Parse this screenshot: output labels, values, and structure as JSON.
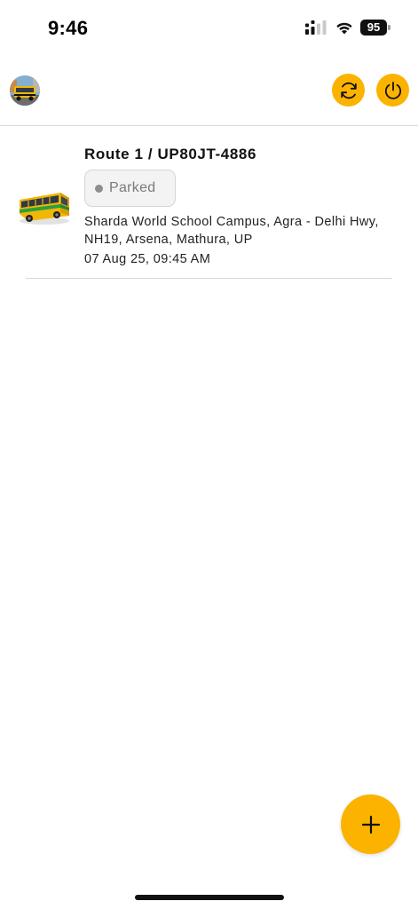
{
  "status_bar": {
    "time": "9:46",
    "battery_level": "95",
    "signal_icon": "cellular-signal-icon",
    "wifi_icon": "wifi-icon"
  },
  "header": {
    "avatar_icon": "school-bus-avatar-icon",
    "refresh_icon": "refresh-icon",
    "power_icon": "power-icon"
  },
  "vehicles": [
    {
      "title": "Route 1 / UP80JT-4886",
      "status": "Parked",
      "address_line1": "Sharda World School Campus, Agra - Delhi Hwy,",
      "address_line2": "NH19, Arsena, Mathura, UP",
      "timestamp": "07 Aug 25, 09:45 AM",
      "icon": "school-bus-icon"
    }
  ],
  "fab": {
    "icon": "plus-icon"
  },
  "colors": {
    "accent": "#fbb300",
    "status_parked": "#8e8e8e",
    "divider": "#d6d6d6"
  }
}
